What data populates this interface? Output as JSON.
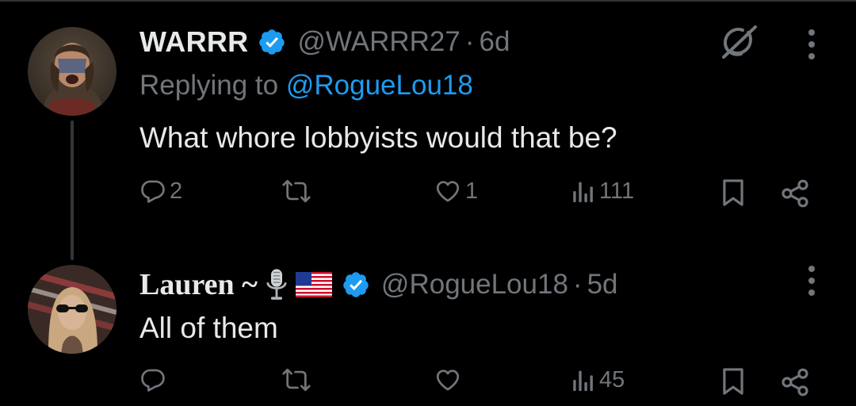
{
  "tweets": [
    {
      "display_name": "WARRR",
      "handle": "@WARRR27",
      "separator": "·",
      "time": "6d",
      "replying_prefix": "Replying to",
      "replying_to": "@RogueLou18",
      "text": "What whore lobbyists would that be?",
      "replies": "2",
      "reposts": "",
      "likes": "1",
      "views": "111",
      "verified": true
    },
    {
      "display_name": "Lauren ~",
      "name_emoji": [
        "microphone",
        "us-flag"
      ],
      "handle": "@RogueLou18",
      "separator": "·",
      "time": "5d",
      "text": "All of them",
      "replies": "",
      "reposts": "",
      "likes": "",
      "views": "45",
      "verified": true
    }
  ],
  "colors": {
    "background": "#000000",
    "text_primary": "#e7e9ea",
    "text_secondary": "#71767b",
    "accent": "#1d9bf0",
    "thread_line": "#333639"
  },
  "icons": [
    "grok-icon",
    "more-icon",
    "reply-icon",
    "repost-icon",
    "like-icon",
    "views-icon",
    "bookmark-icon",
    "share-icon",
    "verified-badge-icon"
  ]
}
